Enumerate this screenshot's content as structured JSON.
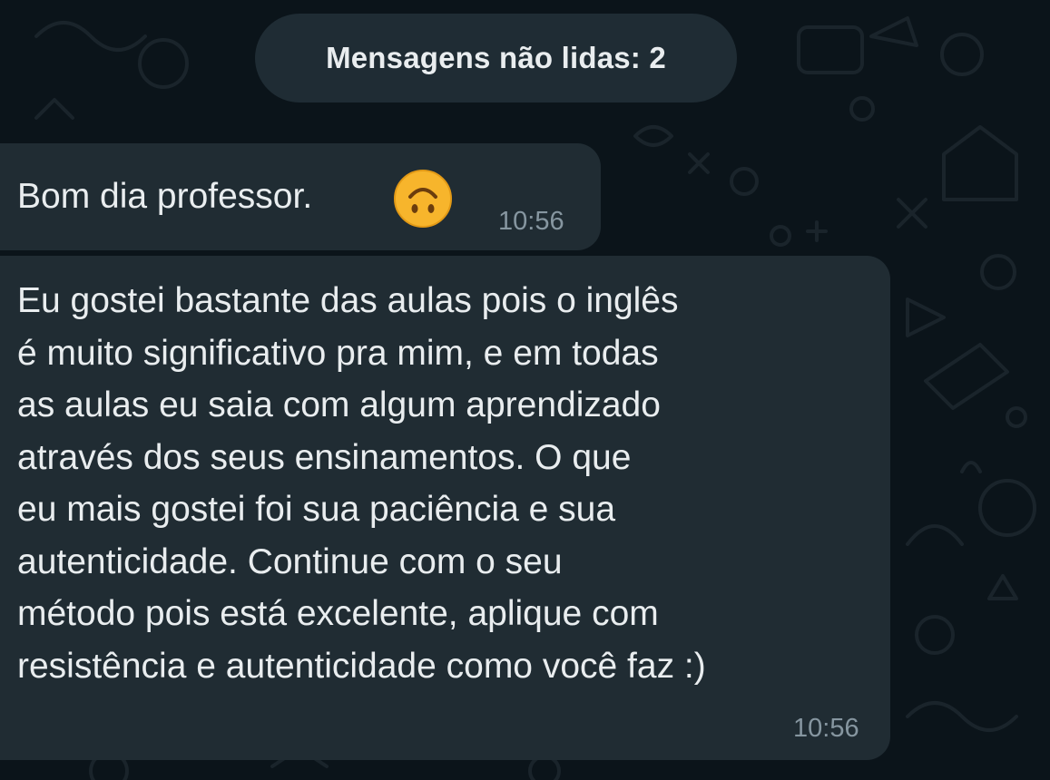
{
  "unread_banner": {
    "text": "Mensagens não lidas: 2"
  },
  "messages": [
    {
      "text": "Bom dia professor.",
      "emoji": "upside-down-face",
      "time": "10:56"
    },
    {
      "text": "Eu gostei bastante das aulas pois o inglês\né muito significativo pra mim, e em todas\nas aulas eu saia com algum aprendizado\natravés dos seus ensinamentos. O que\neu mais gostei foi sua paciência e sua\nautenticidade. Continue com o seu\nmétodo pois está excelente, aplique com\nresistência e autenticidade como você faz :)",
      "time": "10:56"
    }
  ],
  "colors": {
    "background": "#0b141a",
    "bubble": "#202c33",
    "text": "#e9edef",
    "timestamp": "#8696a0",
    "emoji": "#f7b52c"
  }
}
